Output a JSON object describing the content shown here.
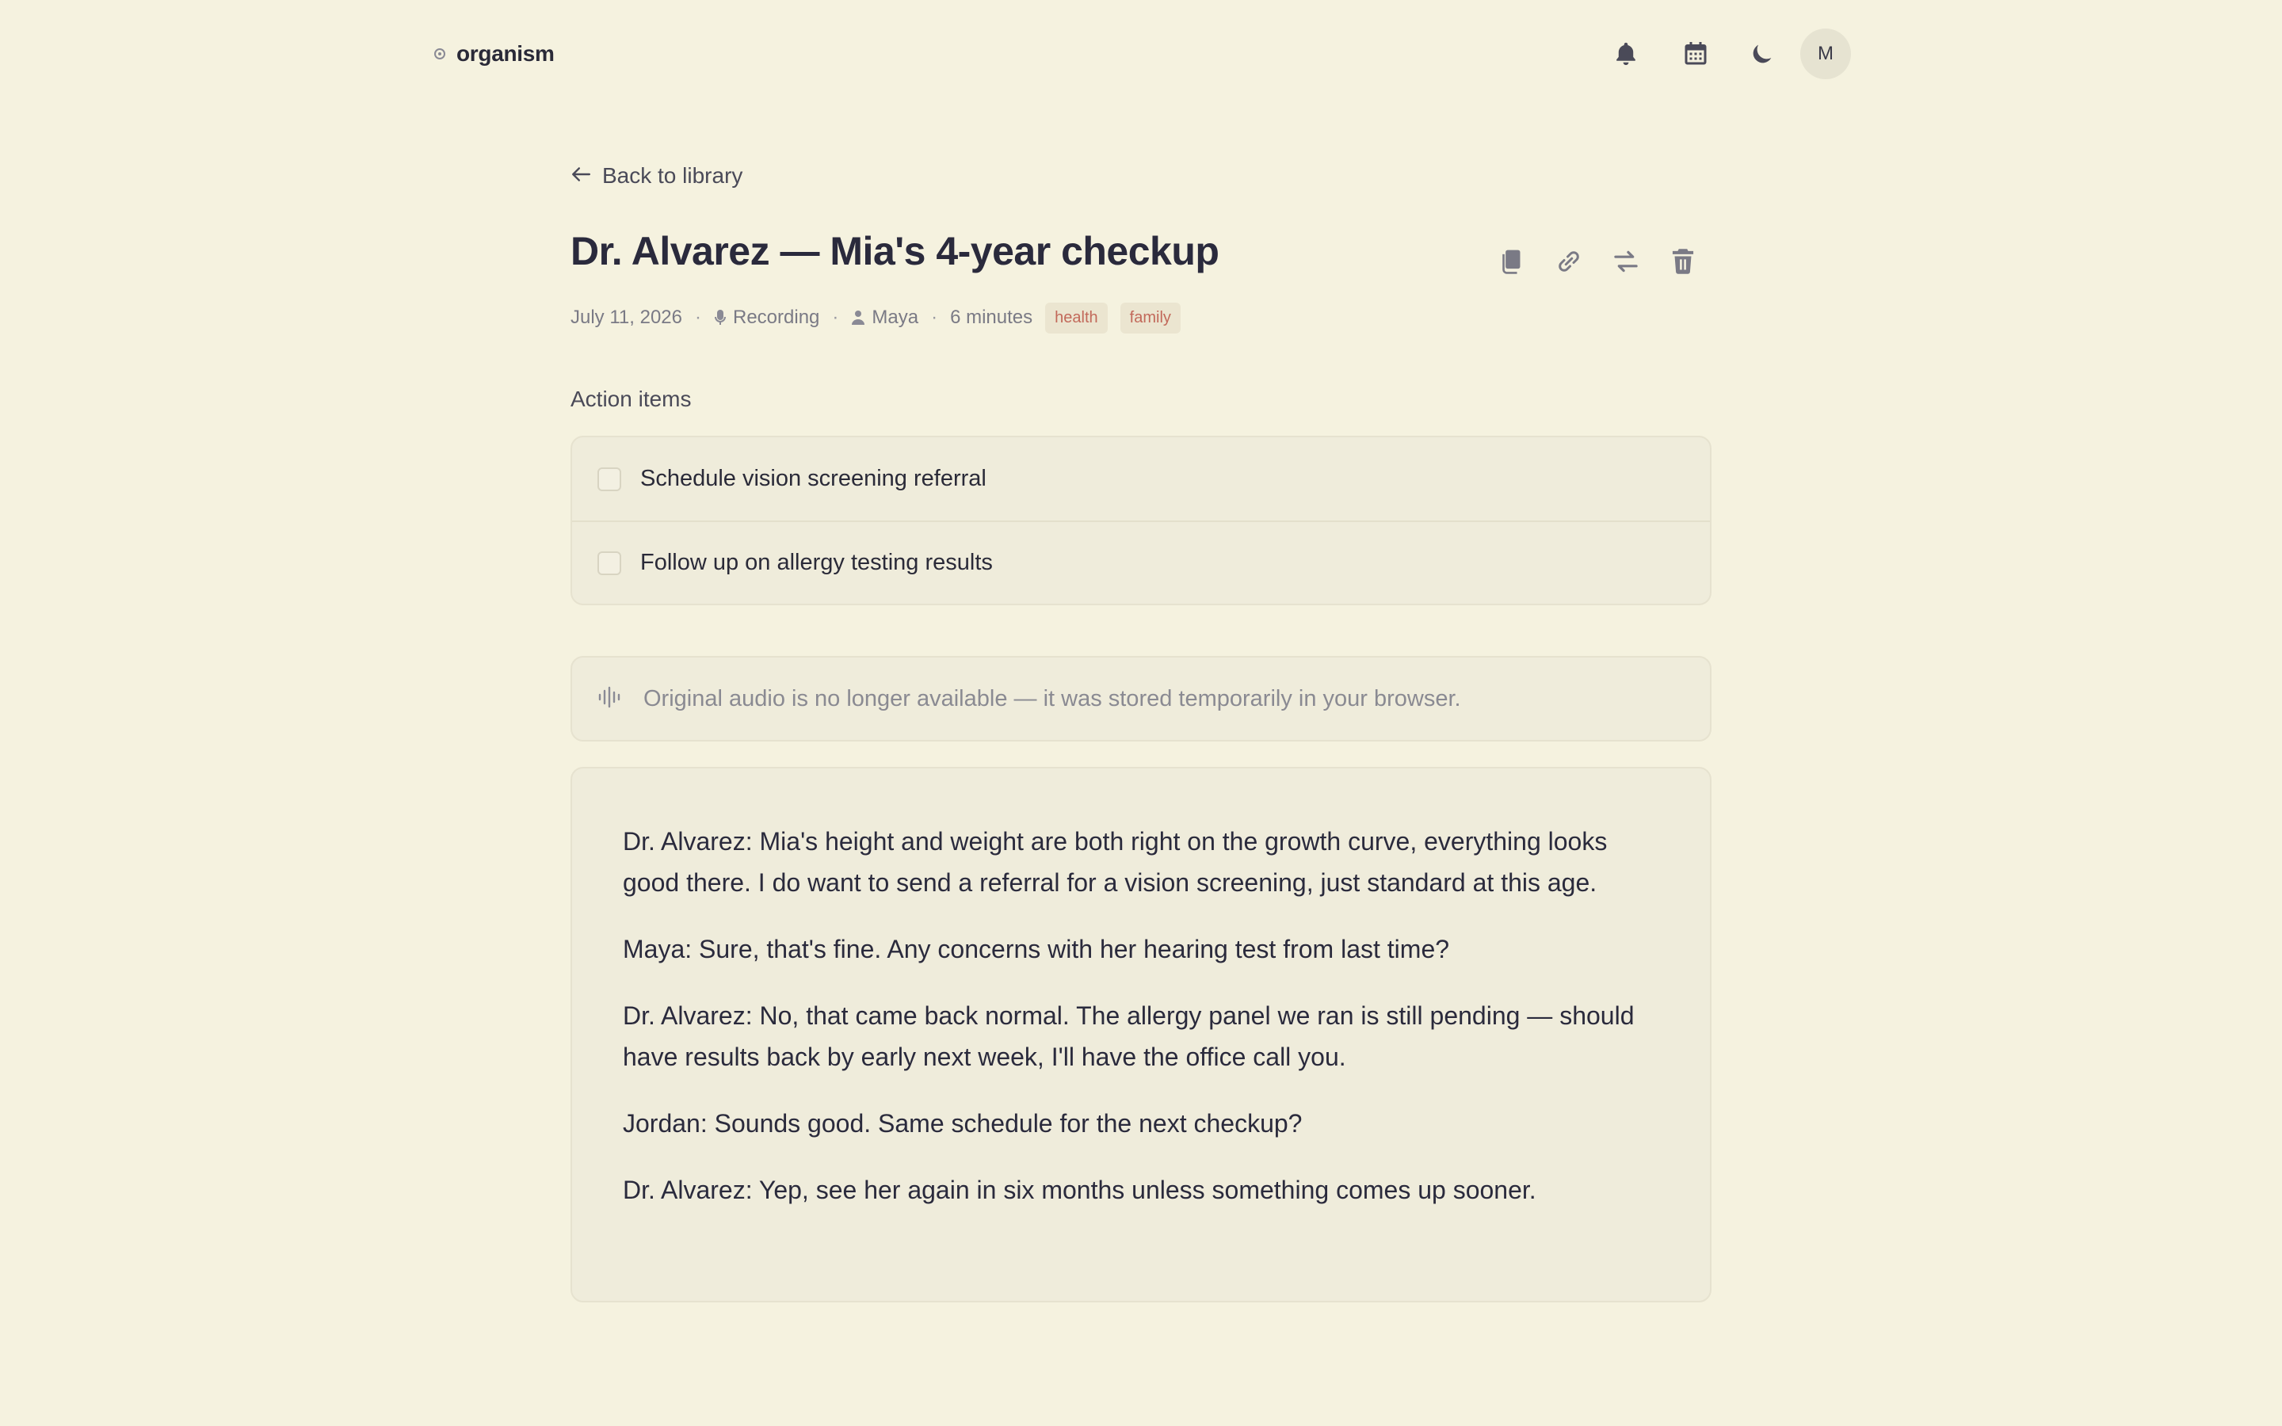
{
  "app": {
    "name": "organism"
  },
  "header": {
    "icons": [
      "bell-icon",
      "calendar-icon",
      "moon-icon"
    ],
    "avatar_initial": "M"
  },
  "nav": {
    "back_label": "Back to library"
  },
  "note": {
    "title": "Dr. Alvarez — Mia's 4-year checkup",
    "date": "July 11, 2026",
    "source": "Recording",
    "owner": "Maya",
    "duration": "6 minutes",
    "tags": [
      "health",
      "family"
    ]
  },
  "toolbar": {
    "icons": [
      "copy-icon",
      "link-icon",
      "swap-icon",
      "trash-icon"
    ]
  },
  "action_items": {
    "label": "Action items",
    "items": [
      {
        "text": "Schedule vision screening referral",
        "checked": false
      },
      {
        "text": "Follow up on allergy testing results",
        "checked": false
      }
    ]
  },
  "audio_notice": {
    "icon": "audio-wave-icon",
    "text": "Original audio is no longer available — it was stored temporarily in your browser."
  },
  "transcript": {
    "paragraphs": [
      "Dr. Alvarez: Mia's height and weight are both right on the growth curve, everything looks good there. I do want to send a referral for a vision screening, just standard at this age.",
      "Maya: Sure, that's fine. Any concerns with her hearing test from last time?",
      "Dr. Alvarez: No, that came back normal. The allergy panel we ran is still pending — should have results back by early next week, I'll have the office call you.",
      "Jordan: Sounds good. Same schedule for the next checkup?",
      "Dr. Alvarez: Yep, see her again in six months unless something comes up sooner."
    ]
  },
  "colors": {
    "background": "#f5f2df",
    "card": "#efecdb",
    "text": "#2a2a38",
    "muted": "#7a7a85",
    "tag_text": "#c2695a",
    "tag_bg": "#ebe5d0"
  }
}
